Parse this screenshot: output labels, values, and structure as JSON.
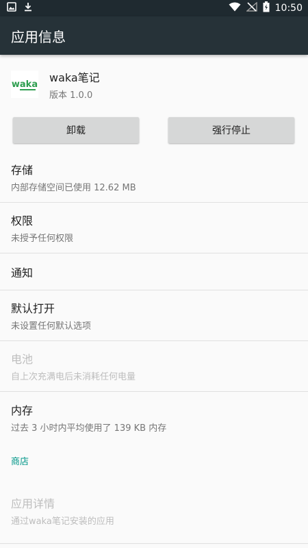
{
  "status_bar": {
    "time": "10:50",
    "left_icons": [
      "image-icon",
      "download-icon"
    ],
    "right_icons": [
      "wifi-icon",
      "no-signal-icon",
      "battery-icon"
    ]
  },
  "app_bar": {
    "title": "应用信息"
  },
  "app": {
    "icon_text": "waka",
    "name": "waka笔记",
    "version": "版本 1.0.0"
  },
  "buttons": {
    "uninstall": "卸载",
    "force_stop": "强行停止"
  },
  "items": [
    {
      "title": "存储",
      "summary": "内部存储空间已使用 12.62 MB"
    },
    {
      "title": "权限",
      "summary": "未授予任何权限"
    },
    {
      "title": "通知"
    },
    {
      "title": "默认打开",
      "summary": "未设置任何默认选项"
    },
    {
      "title": "电池",
      "summary": "自上次充满电后未消耗任何电量"
    },
    {
      "title": "内存",
      "summary": "过去 3 小时内平均使用了 139 KB 内存"
    }
  ],
  "store": {
    "category": "商店",
    "title": "应用详情",
    "summary": "通过waka笔记安装的应用"
  },
  "colors": {
    "status_bar": "#1f2a30",
    "app_bar": "#263238",
    "accent": "#009688",
    "button": "#d6d7d7",
    "app_icon_green": "#2e9e4f"
  }
}
